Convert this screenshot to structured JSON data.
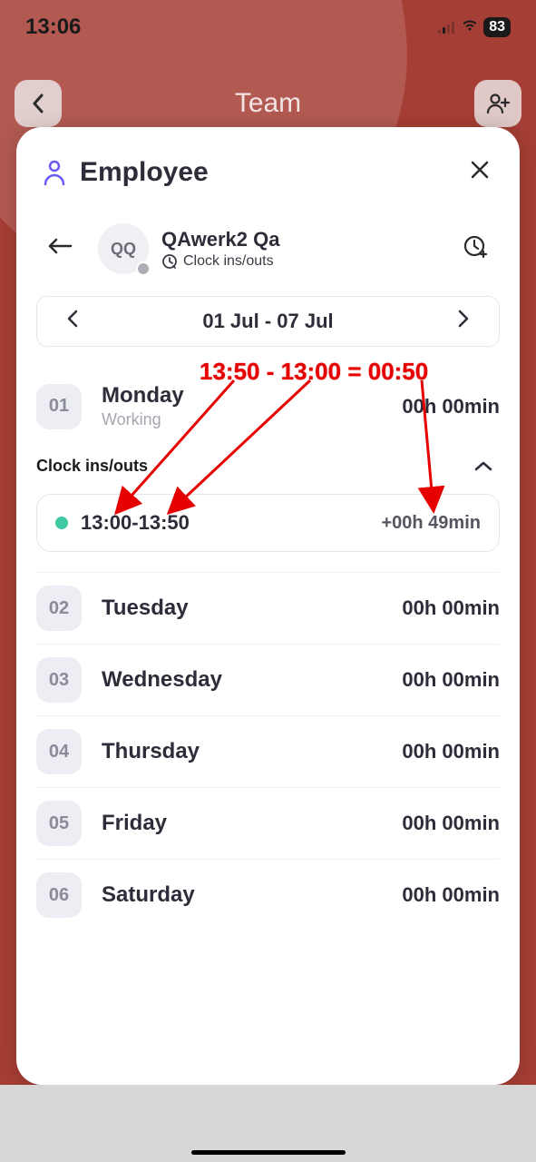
{
  "status": {
    "time": "13:06",
    "battery": "83"
  },
  "topnav": {
    "title": "Team"
  },
  "sheet": {
    "title": "Employee",
    "profile": {
      "initials": "QQ",
      "name": "QAwerk2 Qa",
      "subtitle": "Clock ins/outs"
    },
    "date_range": "01 Jul - 07 Jul",
    "clock_section_title": "Clock ins/outs",
    "clock_entry": {
      "range": "13:00-13:50",
      "duration": "+00h 49min"
    },
    "days": [
      {
        "num": "01",
        "name": "Monday",
        "status": "Working",
        "duration": "00h 00min"
      },
      {
        "num": "02",
        "name": "Tuesday",
        "status": "",
        "duration": "00h 00min"
      },
      {
        "num": "03",
        "name": "Wednesday",
        "status": "",
        "duration": "00h 00min"
      },
      {
        "num": "04",
        "name": "Thursday",
        "status": "",
        "duration": "00h 00min"
      },
      {
        "num": "05",
        "name": "Friday",
        "status": "",
        "duration": "00h 00min"
      },
      {
        "num": "06",
        "name": "Saturday",
        "status": "",
        "duration": "00h 00min"
      }
    ]
  },
  "annotation": {
    "text": "13:50 - 13:00 = 00:50"
  }
}
